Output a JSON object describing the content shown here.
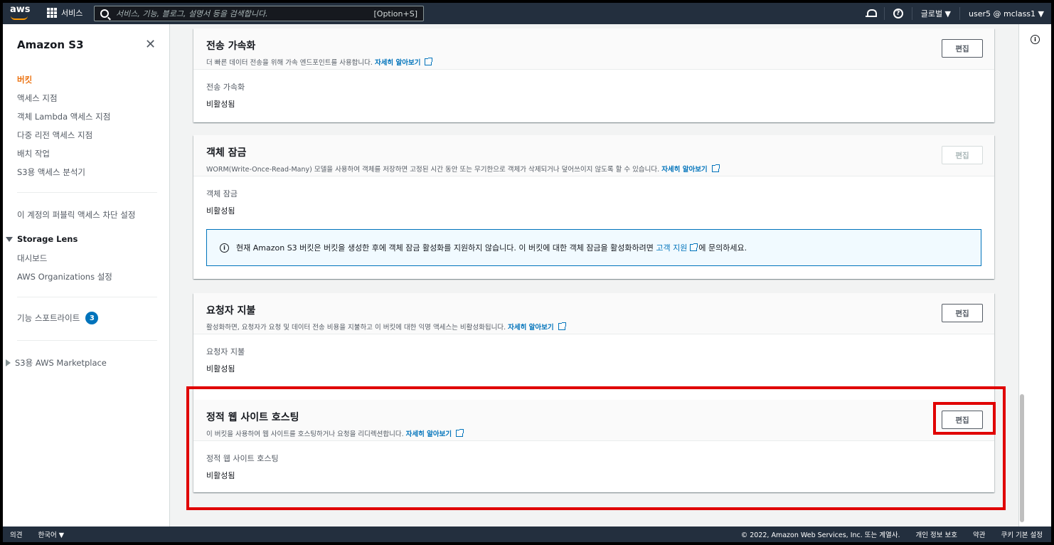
{
  "topnav": {
    "logo": "aws",
    "services_label": "서비스",
    "search_placeholder": "서비스, 기능, 블로그, 설명서 등을 검색합니다.",
    "search_shortcut": "[Option+S]",
    "region_label": "글로벌 ▼",
    "account_label": "user5 @ mclass1 ▼"
  },
  "sidebar": {
    "title": "Amazon S3",
    "items": [
      {
        "label": "버킷"
      },
      {
        "label": "액세스 지점"
      },
      {
        "label": "객체 Lambda 액세스 지점"
      },
      {
        "label": "다중 리전 액세스 지점"
      },
      {
        "label": "배치 작업"
      },
      {
        "label": "S3용 액세스 분석기"
      }
    ],
    "block_public": "이 계정의 퍼블릭 액세스 차단 설정",
    "storage_lens": {
      "title": "Storage Lens",
      "items": [
        {
          "label": "대시보드"
        },
        {
          "label": "AWS Organizations 설정"
        }
      ]
    },
    "feature_spotlight": "기능 스포트라이트",
    "feature_count": "3",
    "marketplace": "S3용 AWS Marketplace"
  },
  "cards": [
    {
      "title": "전송 가속화",
      "description": "더 빠른 데이터 전송을 위해 가속 엔드포인트를 사용합니다.",
      "link": "자세히 알아보기",
      "button": "편집",
      "field_label": "전송 가속화",
      "field_value": "비활성됨"
    },
    {
      "title": "객체 잠금",
      "description": "WORM(Write-Once-Read-Many) 모델을 사용하여 객체를 저장하면 고정된 시간 동안 또는 무기한으로 객체가 삭제되거나 덮어쓰이지 않도록 할 수 있습니다.",
      "link": "자세히 알아보기",
      "button": "편집",
      "field_label": "객체 잠금",
      "field_value": "비활성됨",
      "info_text_before": "현재 Amazon S3 버킷은 버킷을 생성한 후에 객체 잠금 활성화를 지원하지 않습니다. 이 버킷에 대한 객체 잠금을 활성화하려면 ",
      "info_link": "고객 지원",
      "info_text_after": "에 문의하세요."
    },
    {
      "title": "요청자 지불",
      "description": "활성화하면, 요청자가 요청 및 데이터 전송 비용을 지불하고 이 버킷에 대한 익명 액세스는 비활성화됩니다.",
      "link": "자세히 알아보기",
      "button": "편집",
      "field_label": "요청자 지불",
      "field_value": "비활성됨"
    },
    {
      "title": "정적 웹 사이트 호스팅",
      "description": "이 버킷을 사용하여 웹 사이트를 호스팅하거나 요청을 리디렉션합니다.",
      "link": "자세히 알아보기",
      "button": "편집",
      "field_label": "정적 웹 사이트 호스팅",
      "field_value": "비활성됨"
    }
  ],
  "footer": {
    "feedback": "의견",
    "language": "한국어 ▼",
    "copyright": "© 2022, Amazon Web Services, Inc. 또는 계열사.",
    "privacy": "개인 정보 보호",
    "terms": "약관",
    "cookies": "쿠키 기본 설정"
  },
  "colors": {
    "nav_bg": "#232f3e",
    "accent_orange": "#ec7211",
    "link_blue": "#0073bb",
    "highlight_red": "#e00000"
  }
}
